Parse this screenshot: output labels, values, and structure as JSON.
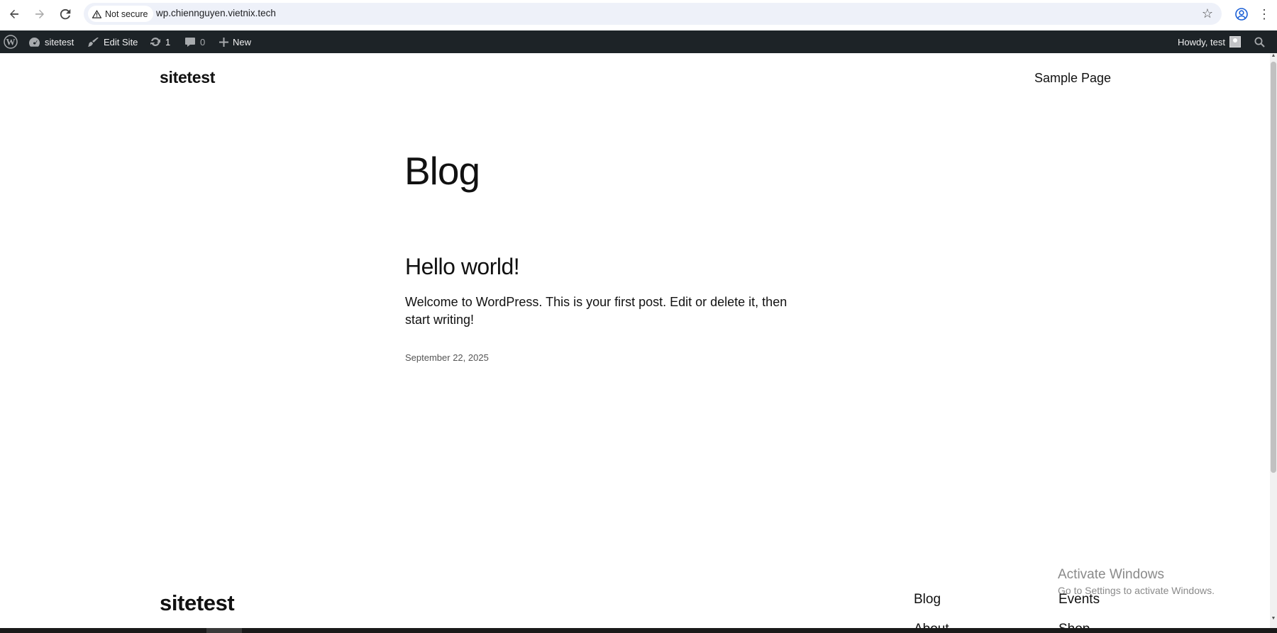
{
  "browser": {
    "security_label": "Not secure",
    "url": "wp.chiennguyen.vietnix.tech"
  },
  "adminbar": {
    "site_name": "sitetest",
    "edit_site": "Edit Site",
    "updates_count": "1",
    "comments_count": "0",
    "new_label": "New",
    "howdy": "Howdy, test"
  },
  "site": {
    "title": "sitetest",
    "nav": [
      "Sample Page"
    ]
  },
  "main": {
    "heading": "Blog",
    "posts": [
      {
        "title": "Hello world!",
        "excerpt": "Welcome to WordPress. This is your first post. Edit or delete it, then start writing!",
        "date": "September 22, 2025"
      }
    ]
  },
  "footer": {
    "title": "sitetest",
    "links": [
      "Blog",
      "Events",
      "About",
      "Shop"
    ]
  },
  "watermark": {
    "title": "Activate Windows",
    "subtitle": "Go to Settings to activate Windows."
  },
  "colors": {
    "adminbar_bg": "#1d2327",
    "omnibox_bg": "#eef1f9",
    "text": "#111111"
  }
}
